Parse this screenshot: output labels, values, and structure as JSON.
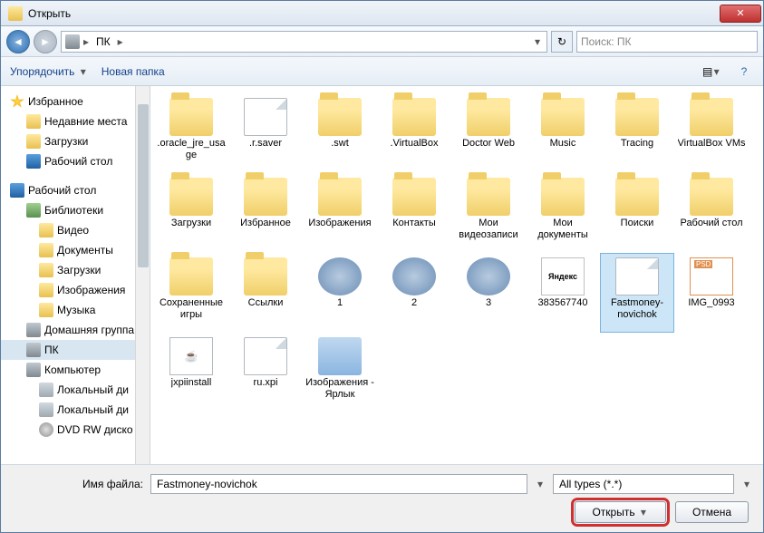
{
  "title": "Открыть",
  "breadcrumb": [
    "ПК"
  ],
  "search_placeholder": "Поиск: ПК",
  "toolbar": {
    "organize": "Упорядочить",
    "newfolder": "Новая папка"
  },
  "sidebar": {
    "favorites": "Избранное",
    "fav_items": [
      "Недавние места",
      "Загрузки",
      "Рабочий стол"
    ],
    "desktop": "Рабочий стол",
    "libs": "Библиотеки",
    "lib_items": [
      "Видео",
      "Документы",
      "Загрузки",
      "Изображения",
      "Музыка"
    ],
    "home": "Домашняя группа",
    "pk": "ПК",
    "computer": "Компьютер",
    "comp_items": [
      "Локальный ди",
      "Локальный ди",
      "DVD RW диско"
    ]
  },
  "items": [
    {
      "n": ".oracle_jre_usage",
      "t": "folder"
    },
    {
      "n": ".r.saver",
      "t": "file"
    },
    {
      "n": ".swt",
      "t": "folder"
    },
    {
      "n": ".VirtualBox",
      "t": "folder"
    },
    {
      "n": "Doctor Web",
      "t": "folder"
    },
    {
      "n": "Music",
      "t": "folder"
    },
    {
      "n": "Tracing",
      "t": "folder"
    },
    {
      "n": "VirtualBox VMs",
      "t": "folder"
    },
    {
      "n": "Загрузки",
      "t": "folder"
    },
    {
      "n": "Избранное",
      "t": "folder"
    },
    {
      "n": "Изображения",
      "t": "folder"
    },
    {
      "n": "Контакты",
      "t": "folder"
    },
    {
      "n": "Мои видеозаписи",
      "t": "folder"
    },
    {
      "n": "Мои документы",
      "t": "folder"
    },
    {
      "n": "Поиски",
      "t": "folder"
    },
    {
      "n": "Рабочий стол",
      "t": "folder"
    },
    {
      "n": "Сохраненные игры",
      "t": "folder"
    },
    {
      "n": "Ссылки",
      "t": "folder"
    },
    {
      "n": "1",
      "t": "torrent"
    },
    {
      "n": "2",
      "t": "torrent"
    },
    {
      "n": "3",
      "t": "torrent"
    },
    {
      "n": "383567740",
      "t": "yandex"
    },
    {
      "n": "Fastmoney-novichok",
      "t": "file",
      "sel": true
    },
    {
      "n": "IMG_0993",
      "t": "psd"
    },
    {
      "n": "jxpiinstall",
      "t": "java"
    },
    {
      "n": "ru.xpi",
      "t": "file"
    },
    {
      "n": "Изображения - Ярлык",
      "t": "shortcut"
    }
  ],
  "footer": {
    "fname_label": "Имя файла:",
    "fname_value": "Fastmoney-novichok",
    "ftype": "All types (*.*)",
    "open": "Открыть",
    "cancel": "Отмена"
  }
}
